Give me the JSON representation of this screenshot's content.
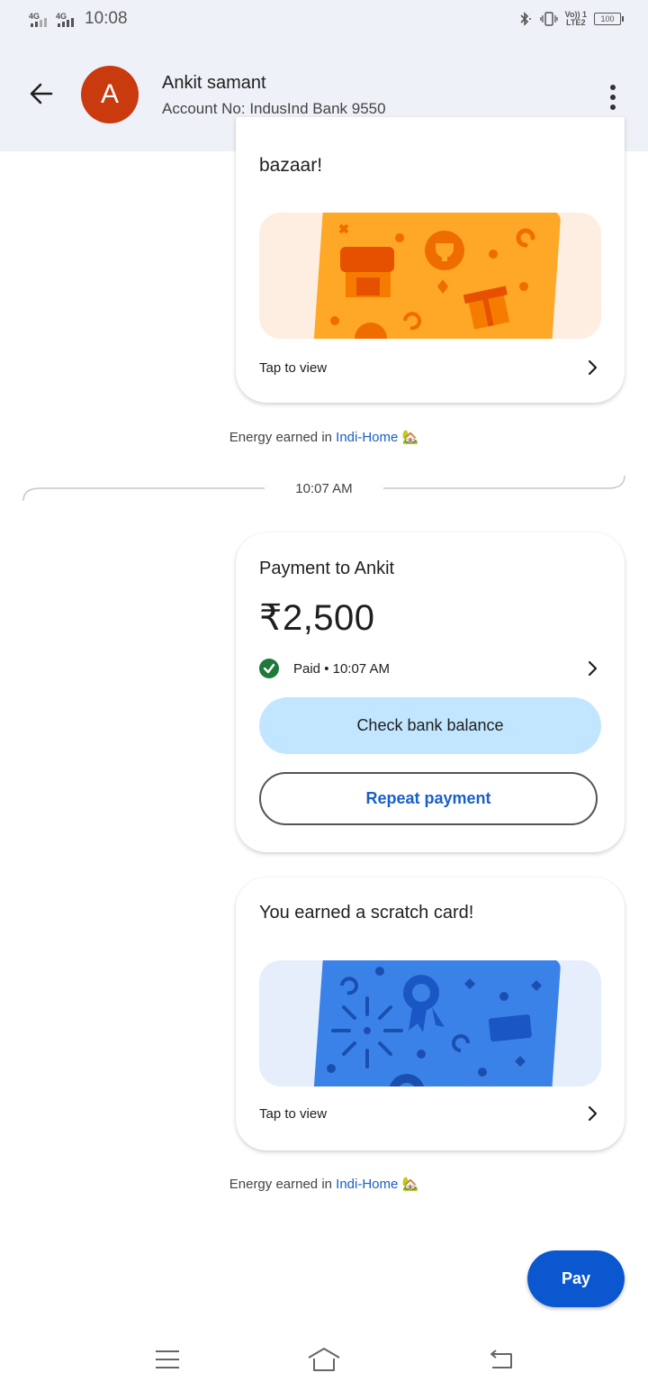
{
  "status_bar": {
    "network_1": "4G",
    "network_2": "4G",
    "time": "10:08",
    "volte": "Vo)) 1\nLTE2",
    "battery": "100"
  },
  "header": {
    "avatar_letter": "A",
    "contact_name": "Ankit samant",
    "account_line": "Account No: IndusInd Bank 9550"
  },
  "messages": {
    "scratch_card_1": {
      "title_tail": "bazaar!",
      "tap_label": "Tap to view",
      "art_color": "#ffa726",
      "art_bg": "#fdeee1"
    },
    "energy_1": {
      "prefix": "Energy earned in ",
      "link": "Indi-Home",
      "emoji": "🏡"
    },
    "time_divider": "10:07 AM",
    "payment": {
      "title": "Payment to Ankit",
      "amount": "₹2,500",
      "status": "Paid • 10:07 AM",
      "check_balance_label": "Check bank balance",
      "repeat_label": "Repeat payment"
    },
    "scratch_card_2": {
      "title": "You earned a scratch card!",
      "tap_label": "Tap to view",
      "art_color": "#3b82e8",
      "art_bg": "#e6eefb"
    },
    "energy_2": {
      "prefix": "Energy earned in ",
      "link": "Indi-Home",
      "emoji": "🏡"
    }
  },
  "pay_button": {
    "label": "Pay"
  },
  "colors": {
    "header_bg": "#eef1f7",
    "avatar": "#c93a0e",
    "primary": "#0b57d0",
    "link": "#1a5fc7",
    "success": "#1e7a3a",
    "balance_button_bg": "#c2e6ff"
  },
  "nav_icons": [
    "menu-icon",
    "home-icon",
    "back-icon"
  ]
}
